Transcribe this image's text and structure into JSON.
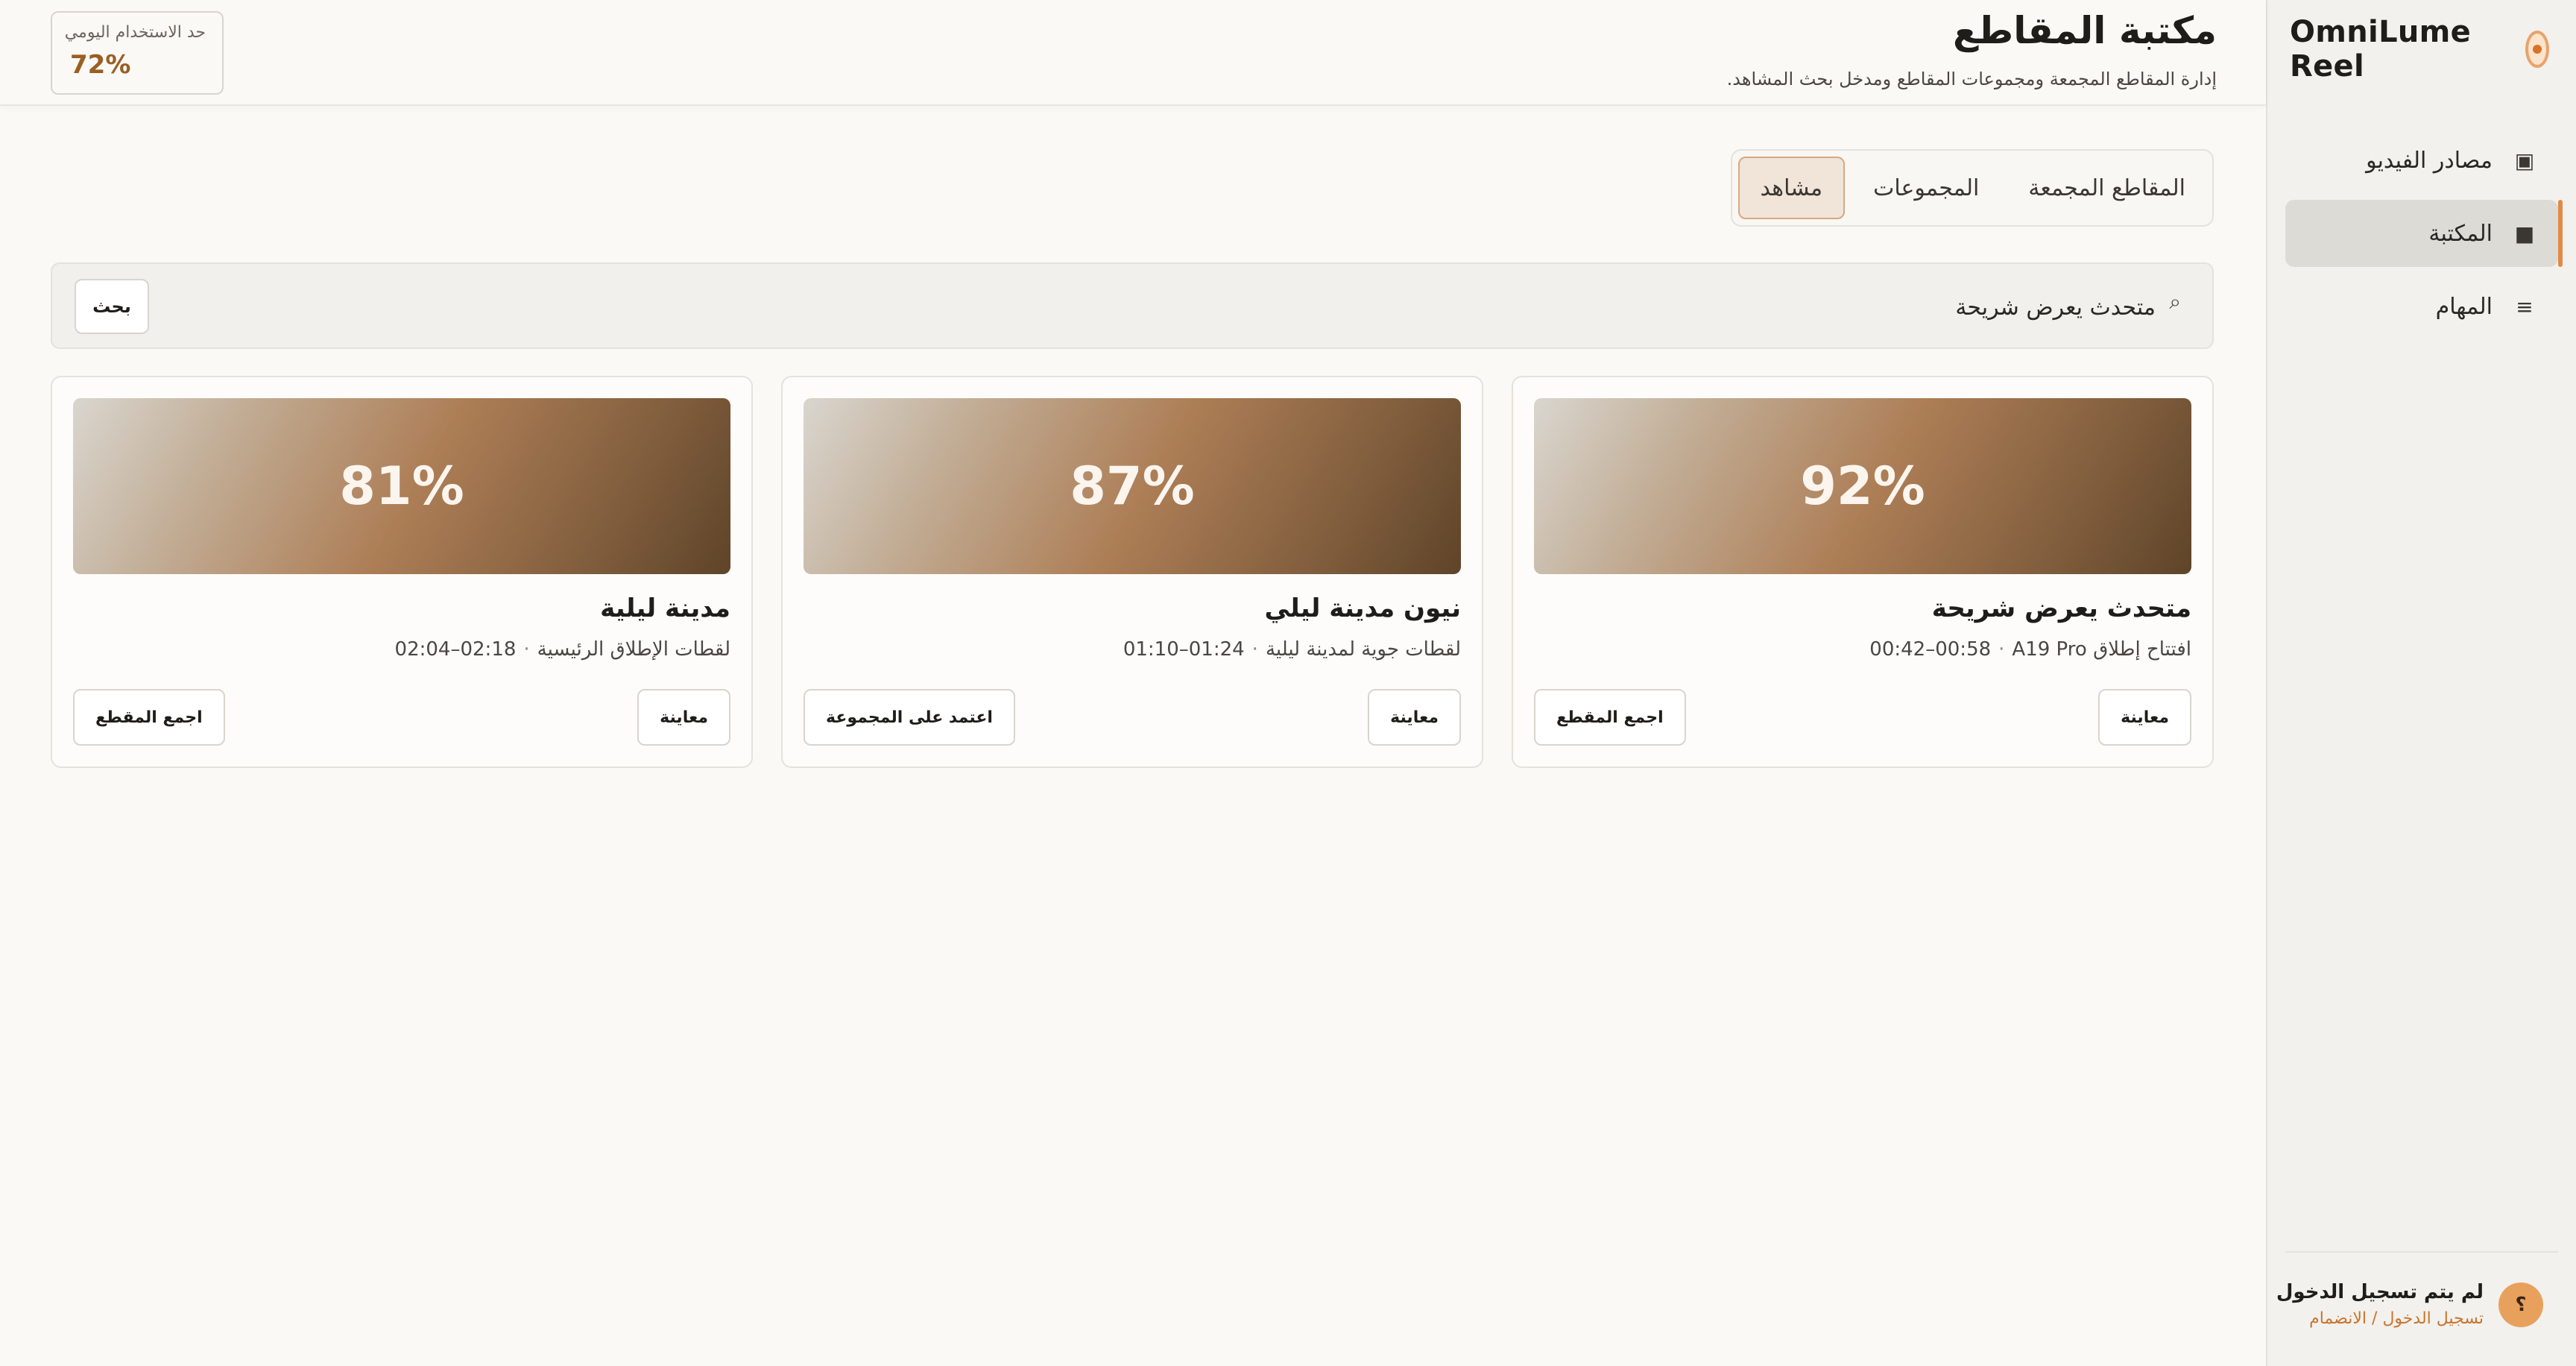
{
  "app": {
    "name": "OmniLume Reel"
  },
  "sidebar": {
    "items": [
      {
        "label": "مصادر الفيديو",
        "icon": "video-source-icon"
      },
      {
        "label": "المكتبة",
        "icon": "library-square-icon"
      },
      {
        "label": "المهام",
        "icon": "tasks-list-icon"
      }
    ],
    "active_index": 1,
    "user": {
      "avatar": "؟",
      "status": "لم يتم تسجيل الدخول",
      "login_link": "تسجيل الدخول / الانضمام"
    }
  },
  "header": {
    "title": "مكتبة المقاطع",
    "subtitle": "إدارة المقاطع المجمعة ومجموعات المقاطع ومدخل بحث المشاهد.",
    "quota_label": "حد الاستخدام اليومي",
    "quota_value": "72%"
  },
  "tabs": [
    {
      "label": "المقاطع المجمعة"
    },
    {
      "label": "المجموعات"
    },
    {
      "label": "مشاهد"
    }
  ],
  "active_tab": 2,
  "search": {
    "value": "متحدث يعرض شريحة",
    "button": "بحث"
  },
  "results": [
    {
      "score": "92%",
      "title": "متحدث يعرض شريحة",
      "source": "افتتاح إطلاق A19 Pro",
      "range": "00:42–00:58",
      "primary_action": "معاينة",
      "secondary_action": "اجمع المقطع"
    },
    {
      "score": "87%",
      "title": "نيون مدينة ليلي",
      "source": "لقطات جوية لمدينة ليلية",
      "range": "01:10–01:24",
      "primary_action": "معاينة",
      "secondary_action": "اعتمد على المجموعة"
    },
    {
      "score": "81%",
      "title": "مدينة ليلية",
      "source": "لقطات الإطلاق الرئيسية",
      "range": "02:04–02:18",
      "primary_action": "معاينة",
      "secondary_action": "اجمع المقطع"
    }
  ],
  "colors": {
    "accent": "#e08a45",
    "quota": "#9a5f22",
    "background": "#faf9f6"
  }
}
